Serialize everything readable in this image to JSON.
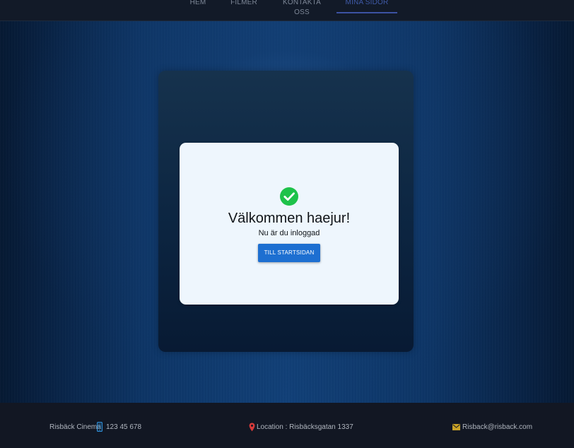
{
  "nav": {
    "items": [
      {
        "label": "HEM"
      },
      {
        "label": "FILMER"
      },
      {
        "label": "KONTAKTA OSS"
      },
      {
        "label": "MINA SIDOR"
      }
    ]
  },
  "card": {
    "icon": "check-circle-icon",
    "title": "Välkommen haejur!",
    "subtitle": "Nu är du inloggad",
    "button_label": "TILL STARTSIDAN"
  },
  "footer": {
    "company": "Risbäck Cinema",
    "phone_icon": "phone-icon",
    "phone": "123 45 678",
    "location_icon": "location-pin-icon",
    "location": "Location : Risbäcksgatan 1337",
    "email_icon": "mail-icon",
    "email": "Risback@risback.com"
  },
  "colors": {
    "accent": "#1d6fd1",
    "check": "#1ec24a",
    "active_nav": "#3f5aa8"
  }
}
